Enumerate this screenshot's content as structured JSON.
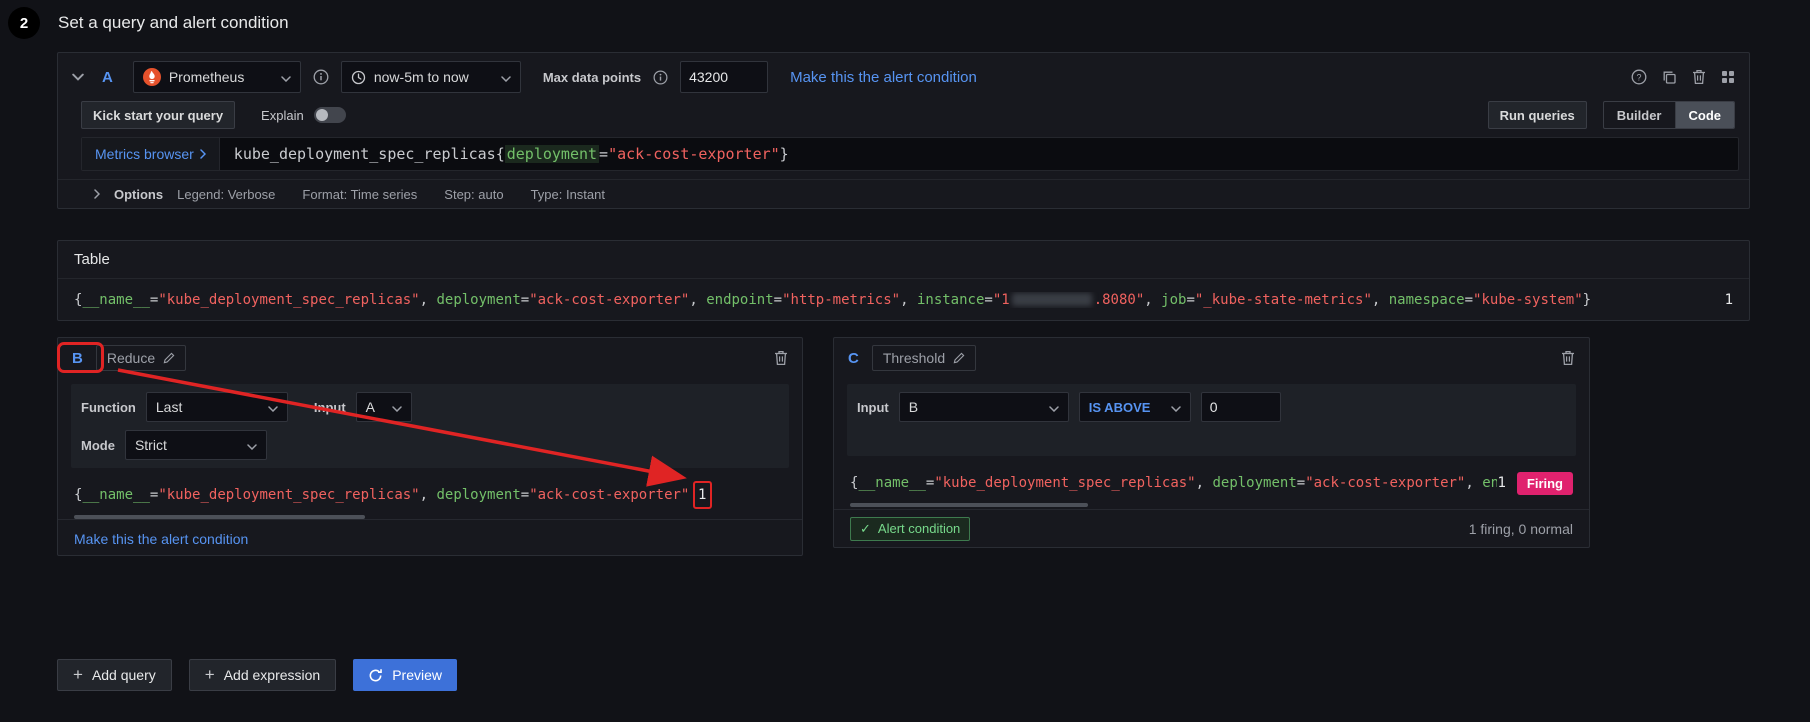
{
  "colors": {
    "accent_blue": "#5794F2",
    "label_green": "#73BF69",
    "value_red": "#F0625F",
    "firing_pink": "#E0226E",
    "annotation_red": "#E02424",
    "panel_bg": "#17181E",
    "page_bg": "#111217"
  },
  "step": {
    "number": "2",
    "title": "Set a query and alert condition"
  },
  "query_a": {
    "ref": "A",
    "datasource": "Prometheus",
    "time_range": "now-5m to now",
    "max_data_points_label": "Max data points",
    "max_data_points_value": "43200",
    "alert_condition_link": "Make this the alert condition",
    "kick_start_button": "Kick start your query",
    "explain_label": "Explain",
    "run_queries_button": "Run queries",
    "builder_tab": "Builder",
    "code_tab": "Code",
    "metrics_browser_label": "Metrics browser",
    "query_tokens": [
      {
        "c": "p",
        "t": "kube_deployment_spec_replicas{"
      },
      {
        "c": "kh",
        "t": "deployment"
      },
      {
        "c": "p",
        "t": "="
      },
      {
        "c": "v",
        "t": "\"ack-cost-exporter\""
      },
      {
        "c": "p",
        "t": "}"
      }
    ],
    "options_label": "Options",
    "options_items": [
      "Legend: Verbose",
      "Format: Time series",
      "Step: auto",
      "Type: Instant"
    ]
  },
  "table": {
    "title": "Table",
    "value": "1"
  },
  "series_tokens": [
    {
      "c": "p",
      "t": "{"
    },
    {
      "c": "k",
      "t": "__name__"
    },
    {
      "c": "p",
      "t": "="
    },
    {
      "c": "v",
      "t": "\"kube_deployment_spec_replicas\""
    },
    {
      "c": "p",
      "t": ", "
    },
    {
      "c": "k",
      "t": "deployment"
    },
    {
      "c": "p",
      "t": "="
    },
    {
      "c": "v",
      "t": "\"ack-cost-exporter\""
    },
    {
      "c": "p",
      "t": ", "
    },
    {
      "c": "k",
      "t": "endpoint"
    },
    {
      "c": "p",
      "t": "="
    },
    {
      "c": "v",
      "t": "\"http-metrics\""
    },
    {
      "c": "p",
      "t": ", "
    },
    {
      "c": "k",
      "t": "instance"
    },
    {
      "c": "p",
      "t": "="
    },
    {
      "c": "v",
      "t": "\"1"
    },
    {
      "c": "blur",
      "t": ""
    },
    {
      "c": "v",
      "t": ".8080\""
    },
    {
      "c": "p",
      "t": ", "
    },
    {
      "c": "k",
      "t": "job"
    },
    {
      "c": "p",
      "t": "="
    },
    {
      "c": "v",
      "t": "\"_kube-state-metrics\""
    },
    {
      "c": "p",
      "t": ", "
    },
    {
      "c": "k",
      "t": "namespace"
    },
    {
      "c": "p",
      "t": "="
    },
    {
      "c": "v",
      "t": "\"kube-system\""
    },
    {
      "c": "p",
      "t": "}"
    }
  ],
  "expr_b": {
    "ref": "B",
    "type_label": "Reduce",
    "function_label": "Function",
    "function_value": "Last",
    "input_label": "Input",
    "input_value": "A",
    "mode_label": "Mode",
    "mode_value": "Strict",
    "result_value": "1",
    "alert_condition_link": "Make this the alert condition"
  },
  "expr_c": {
    "ref": "C",
    "type_label": "Threshold",
    "input_label": "Input",
    "input_value": "B",
    "operator": "IS ABOVE",
    "threshold_value": "0",
    "result_value": "1",
    "firing_badge": "Firing",
    "alert_condition_badge": "Alert condition",
    "status_summary": "1 firing, 0 normal"
  },
  "actions": {
    "add_query": "Add query",
    "add_expression": "Add expression",
    "preview": "Preview"
  }
}
